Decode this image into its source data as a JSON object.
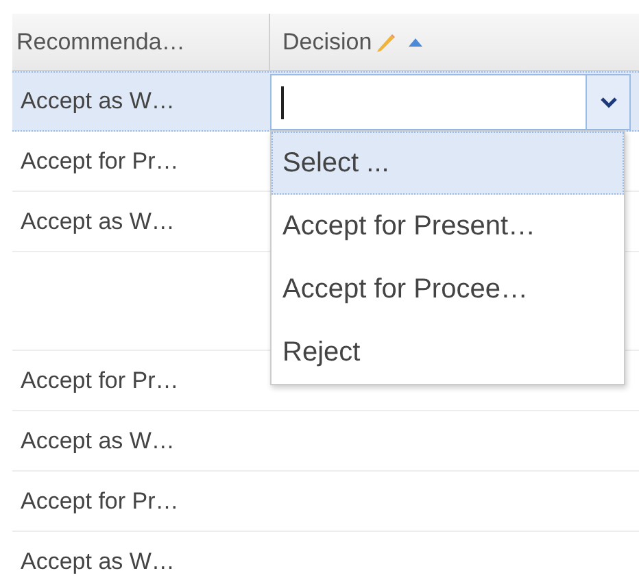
{
  "table": {
    "columns": [
      {
        "label": "Recommenda…",
        "sorted": false
      },
      {
        "label": "Decision",
        "editable": true,
        "sorted": true
      }
    ],
    "rows": [
      {
        "recommendation": "Accept as W…",
        "selected": true
      },
      {
        "recommendation": "Accept for Pr…",
        "selected": false
      },
      {
        "recommendation": "Accept as W…",
        "selected": false
      },
      {
        "selected": false,
        "tall": true
      },
      {
        "recommendation": "Accept for Pr…",
        "selected": false
      },
      {
        "recommendation": "Accept as W…",
        "selected": false
      },
      {
        "recommendation": "Accept for Pr…",
        "selected": false
      },
      {
        "recommendation": "Accept as W…",
        "selected": false
      }
    ]
  },
  "decision_editor": {
    "options": [
      {
        "label": "Select ...",
        "selected": true
      },
      {
        "label": "Accept for Present…",
        "selected": false
      },
      {
        "label": "Accept for Procee…",
        "selected": false
      },
      {
        "label": "Reject",
        "selected": false
      }
    ]
  }
}
